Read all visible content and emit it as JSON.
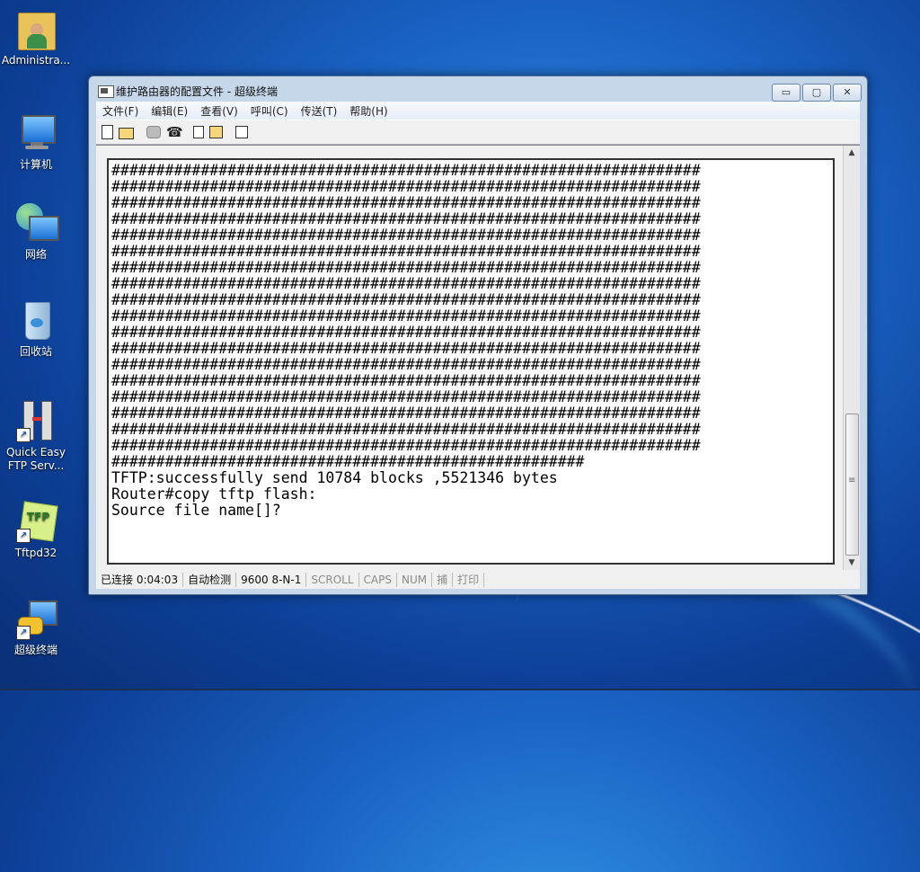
{
  "desktop": {
    "icons": [
      {
        "label": "Administra..."
      },
      {
        "label": "计算机"
      },
      {
        "label": "网络"
      },
      {
        "label": "回收站"
      },
      {
        "label": "Quick Easy FTP Serv..."
      },
      {
        "label": "Tftpd32"
      },
      {
        "label": "超级终端"
      }
    ]
  },
  "window": {
    "title": "维护路由器的配置文件 - 超级终端",
    "menu": [
      "文件(F)",
      "编辑(E)",
      "查看(V)",
      "呼叫(C)",
      "传送(T)",
      "帮助(H)"
    ],
    "controls": {
      "minimize": "▭",
      "maximize": "▢",
      "close": "✕"
    }
  },
  "terminal": {
    "lines": [
      "##################################################################",
      "##################################################################",
      "##################################################################",
      "##################################################################",
      "##################################################################",
      "##################################################################",
      "##################################################################",
      "##################################################################",
      "##################################################################",
      "##################################################################",
      "##################################################################",
      "##################################################################",
      "##################################################################",
      "##################################################################",
      "##################################################################",
      "##################################################################",
      "##################################################################",
      "##################################################################",
      "#####################################################",
      "TFTP:successfully send 10784 blocks ,5521346 bytes",
      "Router#copy tftp flash:",
      "Source file name[]?"
    ]
  },
  "statusbar": {
    "connected": "已连接 0:04:03",
    "detect": "自动检测",
    "settings": "9600 8-N-1",
    "scroll": "SCROLL",
    "caps": "CAPS",
    "num": "NUM",
    "capture": "捕",
    "print": "打印"
  }
}
